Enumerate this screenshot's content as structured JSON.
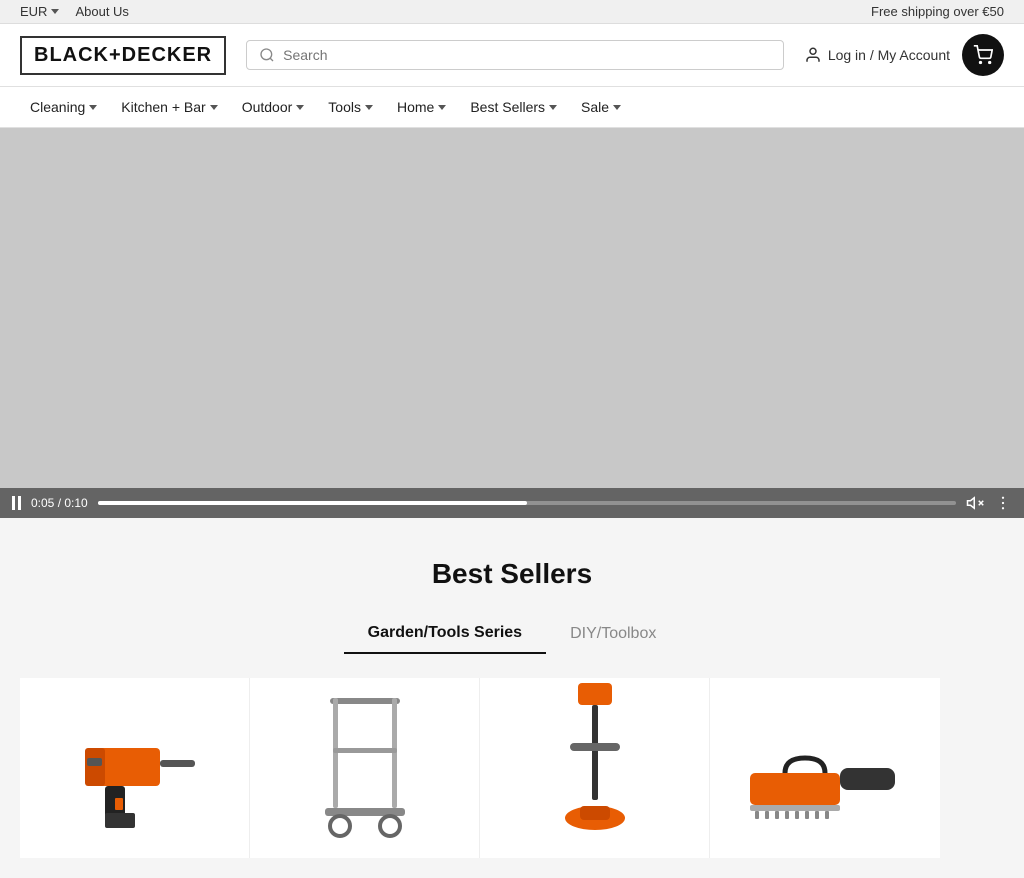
{
  "topbar": {
    "currency": "EUR",
    "about_us": "About Us",
    "shipping_notice": "Free shipping over €50"
  },
  "header": {
    "logo": "BLACK+DECKER",
    "search_placeholder": "Search",
    "account_label": "Log in / My Account",
    "cart_icon": "cart-icon"
  },
  "nav": {
    "items": [
      {
        "label": "Cleaning",
        "has_dropdown": true
      },
      {
        "label": "Kitchen + Bar",
        "has_dropdown": true
      },
      {
        "label": "Outdoor",
        "has_dropdown": true
      },
      {
        "label": "Tools",
        "has_dropdown": true
      },
      {
        "label": "Home",
        "has_dropdown": true
      },
      {
        "label": "Best Sellers",
        "has_dropdown": true
      },
      {
        "label": "Sale",
        "has_dropdown": true
      }
    ]
  },
  "video": {
    "current_time": "0:05",
    "total_time": "0:10",
    "progress_percent": 50
  },
  "best_sellers": {
    "title": "Best Sellers",
    "tabs": [
      {
        "label": "Garden/Tools Series",
        "active": true
      },
      {
        "label": "DIY/Toolbox",
        "active": false
      }
    ],
    "products": [
      {
        "id": "product-1",
        "shape": "1"
      },
      {
        "id": "product-2",
        "shape": "2"
      },
      {
        "id": "product-3",
        "shape": "3"
      },
      {
        "id": "product-4",
        "shape": "4"
      }
    ]
  }
}
